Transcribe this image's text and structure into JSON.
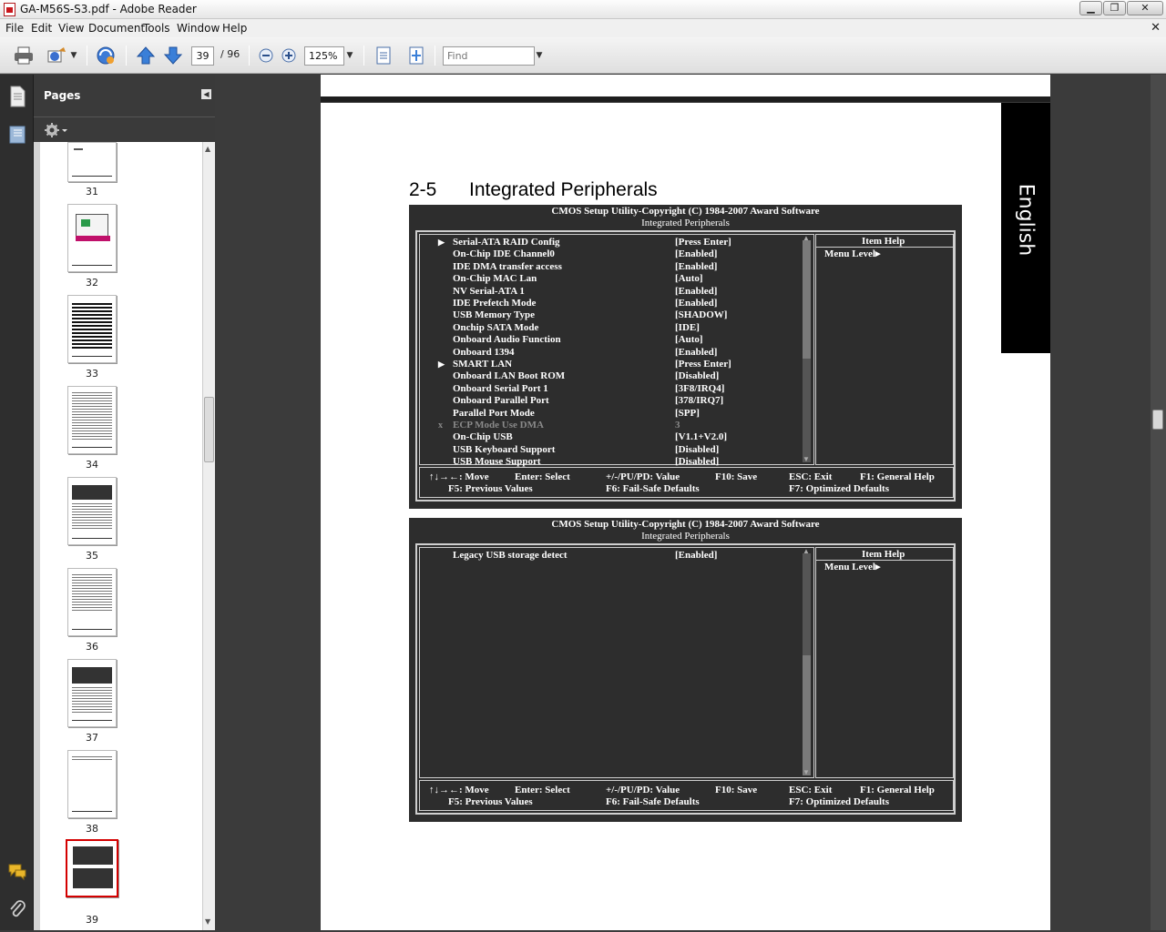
{
  "window": {
    "title": "GA-M56S-S3.pdf - Adobe Reader",
    "controls": [
      "minimize",
      "maximize",
      "close"
    ]
  },
  "menu": [
    "File",
    "Edit",
    "View",
    "Document",
    "Tools",
    "Window",
    "Help"
  ],
  "toolbar": {
    "page_current": "39",
    "page_total": "/ 96",
    "zoom": "125%",
    "find_placeholder": "Find"
  },
  "pages_panel": {
    "title": "Pages",
    "thumbnails": [
      "31",
      "32",
      "33",
      "34",
      "35",
      "36",
      "37",
      "38",
      "39"
    ],
    "selected": "39"
  },
  "document": {
    "side_tab": "English",
    "section_number": "2-5",
    "section_title": "Integrated Peripherals",
    "screen1": {
      "header1": "CMOS Setup Utility-Copyright (C) 1984-2007 Award Software",
      "header2": "Integrated Peripherals",
      "items": [
        {
          "marker": "▶",
          "name": "Serial-ATA RAID Config",
          "value": "[Press Enter]"
        },
        {
          "marker": "",
          "name": "On-Chip IDE Channel0",
          "value": "[Enabled]"
        },
        {
          "marker": "",
          "name": "IDE DMA transfer access",
          "value": "[Enabled]"
        },
        {
          "marker": "",
          "name": "On-Chip MAC Lan",
          "value": "[Auto]"
        },
        {
          "marker": "",
          "name": "NV Serial-ATA 1",
          "value": "[Enabled]"
        },
        {
          "marker": "",
          "name": "IDE Prefetch Mode",
          "value": "[Enabled]"
        },
        {
          "marker": "",
          "name": "USB Memory Type",
          "value": "[SHADOW]"
        },
        {
          "marker": "",
          "name": "Onchip SATA Mode",
          "value": "[IDE]"
        },
        {
          "marker": "",
          "name": "Onboard Audio Function",
          "value": "[Auto]"
        },
        {
          "marker": "",
          "name": "Onboard 1394",
          "value": "[Enabled]"
        },
        {
          "marker": "▶",
          "name": "SMART LAN",
          "value": "[Press Enter]"
        },
        {
          "marker": "",
          "name": "Onboard LAN Boot ROM",
          "value": "[Disabled]"
        },
        {
          "marker": "",
          "name": "Onboard Serial Port 1",
          "value": "[3F8/IRQ4]"
        },
        {
          "marker": "",
          "name": "Onboard Parallel Port",
          "value": "[378/IRQ7]"
        },
        {
          "marker": "",
          "name": "Parallel Port Mode",
          "value": "[SPP]"
        },
        {
          "marker": "x",
          "name": "ECP Mode Use DMA",
          "value": "3",
          "disabled": true
        },
        {
          "marker": "",
          "name": "On-Chip USB",
          "value": "[V1.1+V2.0]"
        },
        {
          "marker": "",
          "name": "USB Keyboard Support",
          "value": "[Disabled]"
        },
        {
          "marker": "",
          "name": "USB Mouse Support",
          "value": "[Disabled]"
        }
      ],
      "help_title": "Item Help",
      "help_text": "Menu Level▸"
    },
    "screen2": {
      "header1": "CMOS Setup Utility-Copyright (C) 1984-2007 Award Software",
      "header2": "Integrated Peripherals",
      "items": [
        {
          "marker": "",
          "name": "Legacy USB storage detect",
          "value": "[Enabled]"
        }
      ],
      "help_title": "Item Help",
      "help_text": "Menu Level▸"
    },
    "footer": {
      "move": "↑↓→←: Move",
      "select": "Enter: Select",
      "value": "+/-/PU/PD: Value",
      "save": "F10: Save",
      "exit": "ESC: Exit",
      "help": "F1: General Help",
      "prev": "F5: Previous Values",
      "failsafe": "F6: Fail-Safe Defaults",
      "optimized": "F7: Optimized Defaults"
    }
  }
}
